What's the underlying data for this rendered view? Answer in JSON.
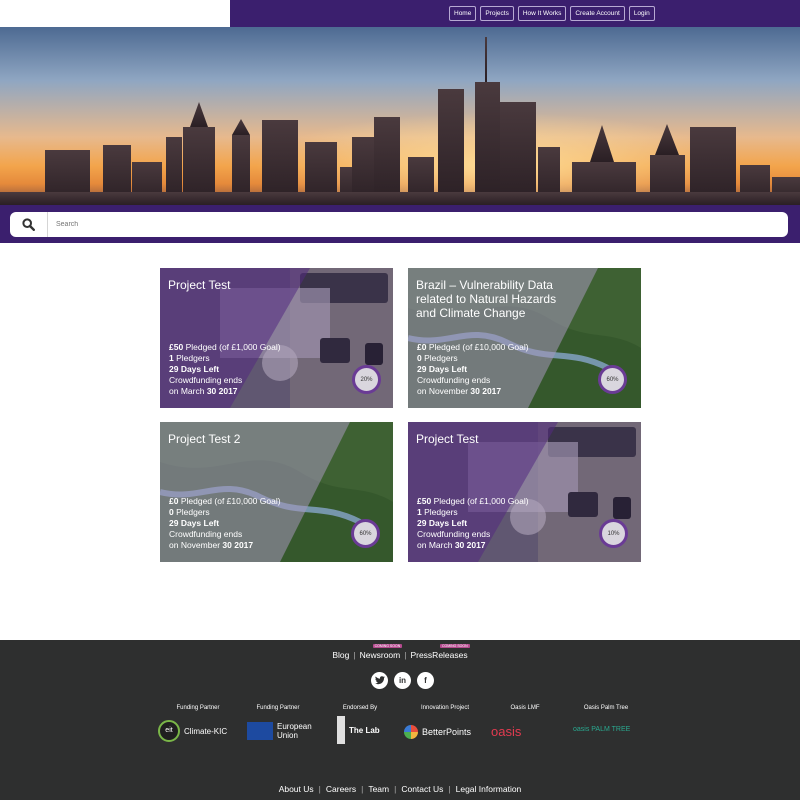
{
  "nav": {
    "items": [
      {
        "label": "Home"
      },
      {
        "label": "Projects"
      },
      {
        "label": "How It Works"
      },
      {
        "label": "Create Account"
      },
      {
        "label": "Login"
      }
    ]
  },
  "search": {
    "placeholder": "Search"
  },
  "icons": {
    "search": "search-icon",
    "social": [
      "twitter-icon",
      "linkedin-icon",
      "facebook-icon"
    ]
  },
  "colors": {
    "brand": "#3b1f6e",
    "footer": "#2e2f2f",
    "accent": "#6a3b95"
  },
  "cards": [
    {
      "title": "Project Test",
      "pledged_amount": "£50",
      "pledged_text": "Pledged (of £1,000 Goal)",
      "pledgers_count": "1",
      "pledgers_text": "Pledgers",
      "days_left": "29 Days Left",
      "ends_text": "Crowdfunding ends",
      "ends_prefix": "on March",
      "ends_date": "30 2017",
      "progress": "20%"
    },
    {
      "title": "Brazil – Vulnerability Data related to Natural Hazards and Climate Change",
      "pledged_amount": "£0",
      "pledged_text": "Pledged (of £10,000 Goal)",
      "pledgers_count": "0",
      "pledgers_text": "Pledgers",
      "days_left": "29 Days Left",
      "ends_text": "Crowdfunding ends",
      "ends_prefix": "on November",
      "ends_date": "30 2017",
      "progress": "60%"
    },
    {
      "title": "Project Test 2",
      "pledged_amount": "£0",
      "pledged_text": "Pledged (of £10,000 Goal)",
      "pledgers_count": "0",
      "pledgers_text": "Pledgers",
      "days_left": "29 Days Left",
      "ends_text": "Crowdfunding ends",
      "ends_prefix": "on November",
      "ends_date": "30 2017",
      "progress": "60%"
    },
    {
      "title": "Project Test",
      "pledged_amount": "£50",
      "pledged_text": "Pledged (of £1,000 Goal)",
      "pledgers_count": "1",
      "pledgers_text": "Pledgers",
      "days_left": "29 Days Left",
      "ends_text": "Crowdfunding ends",
      "ends_prefix": "on March",
      "ends_date": "30 2017",
      "progress": "10%"
    }
  ],
  "footer": {
    "top_links": [
      "Blog",
      "Newsroom",
      "PressReleases"
    ],
    "coming_soon": "COMING SOON",
    "partners": [
      {
        "role": "Funding Partner",
        "name": "Climate-KIC"
      },
      {
        "role": "Funding Partner",
        "name": "European Union"
      },
      {
        "role": "Endorsed By",
        "name": "The Lab"
      },
      {
        "role": "Innovation Project",
        "name": "BetterPoints"
      },
      {
        "role": "Oasis LMF",
        "name": "oasis"
      },
      {
        "role": "Oasis Palm Tree",
        "name": "oasis PALM TREE"
      }
    ],
    "eu_line1": "European",
    "eu_line2": "Union",
    "bottom_links": [
      "About Us",
      "Careers",
      "Team",
      "Contact Us",
      "Legal Information"
    ]
  }
}
